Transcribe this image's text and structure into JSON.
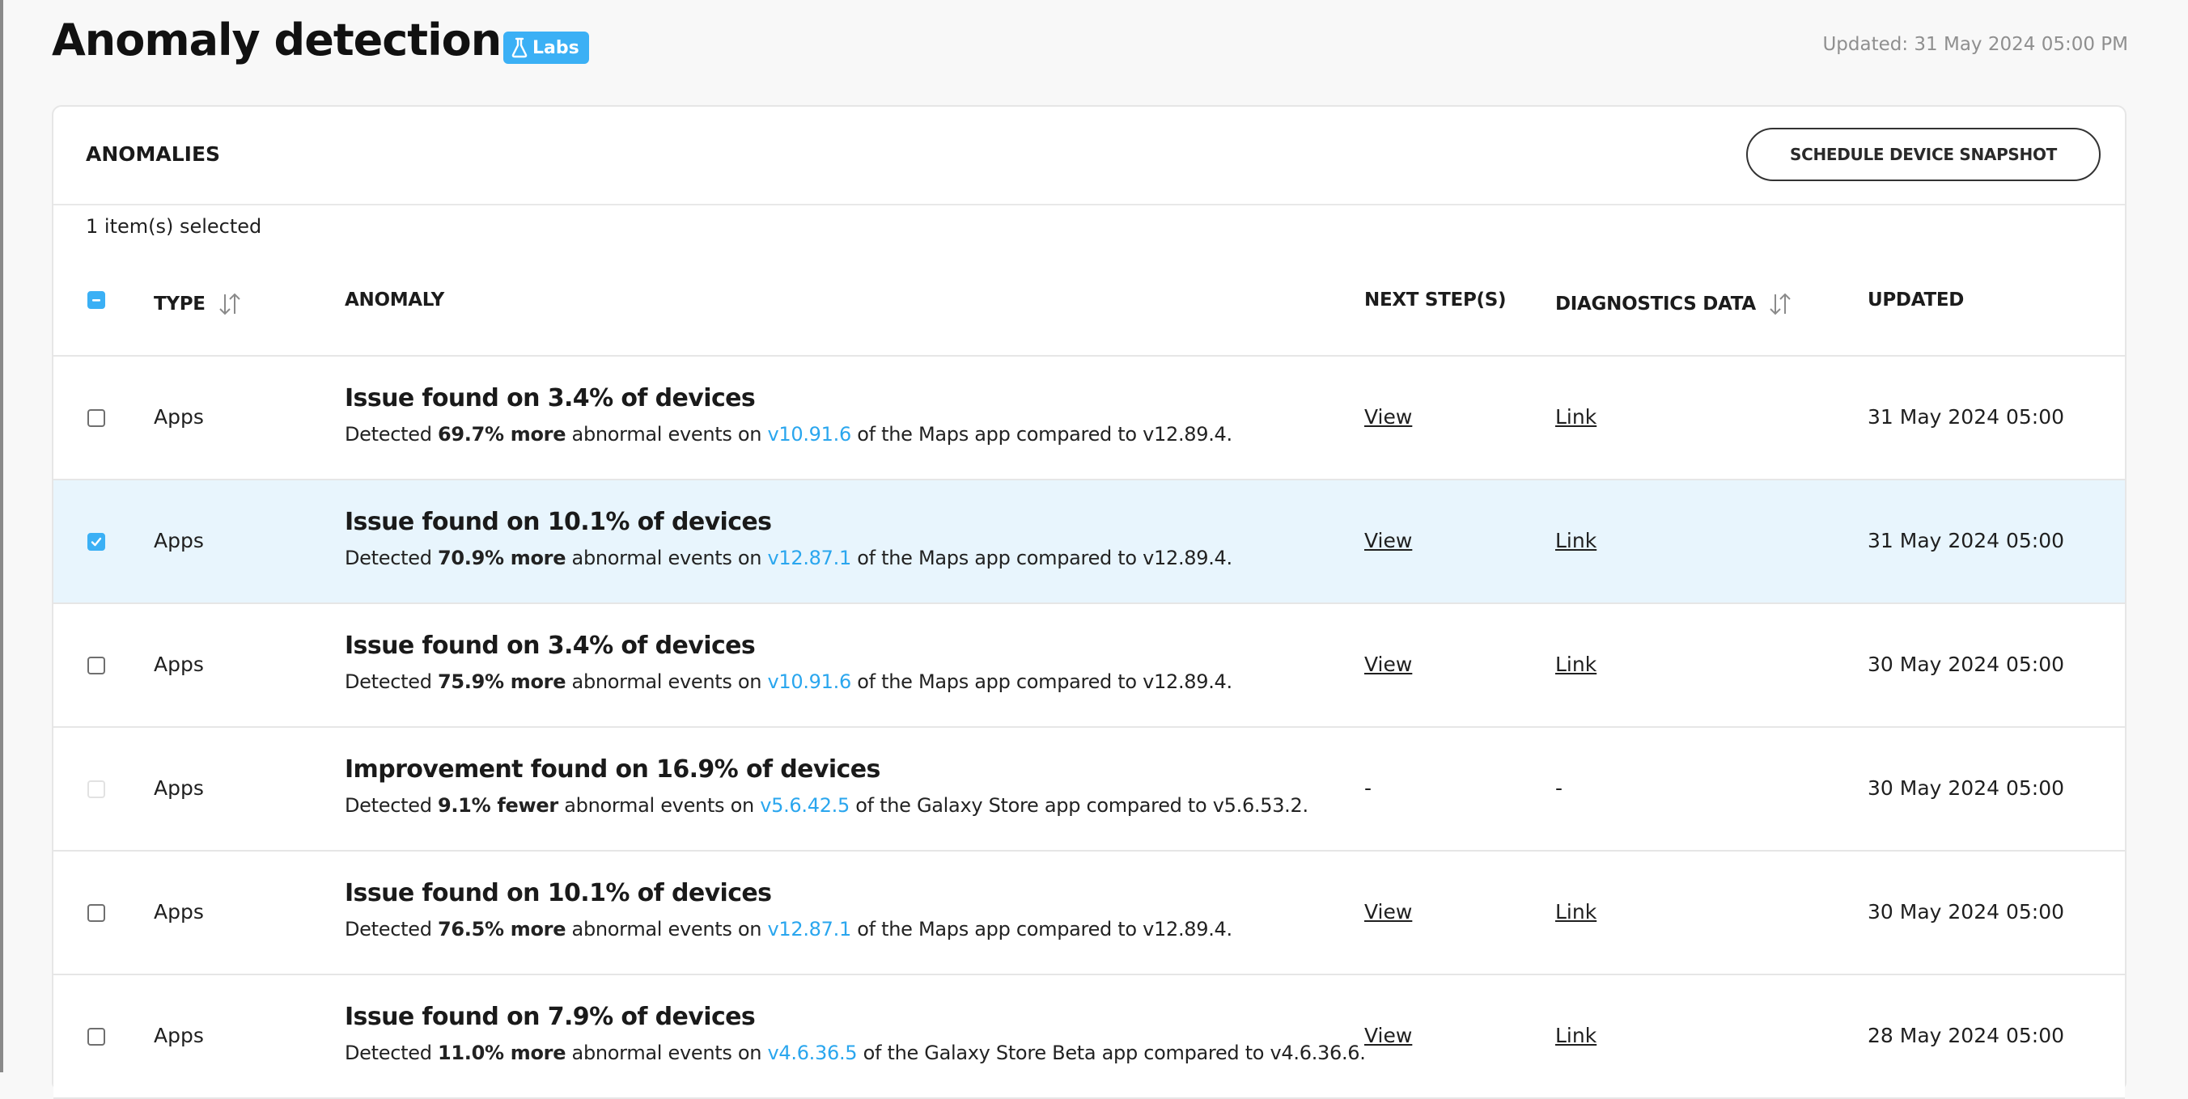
{
  "page": {
    "title": "Anomaly detection",
    "badge": "Labs",
    "updated": "Updated: 31 May 2024 05:00 PM"
  },
  "card": {
    "title": "ANOMALIES",
    "action_button": "SCHEDULE DEVICE SNAPSHOT",
    "selected_count": "1 item(s) selected"
  },
  "columns": {
    "type": "TYPE",
    "anomaly": "ANOMALY",
    "next_steps": "NEXT STEP(S)",
    "diagnostics": "DIAGNOSTICS DATA",
    "updated": "UPDATED"
  },
  "colors": {
    "accent": "#3bb0f5",
    "link": "#2aa6ee",
    "selected_row": "#e8f5fd"
  },
  "rows": [
    {
      "checked": false,
      "disabled": false,
      "type": "Apps",
      "title": "Issue found on 3.4% of devices",
      "desc_prefix": "Detected ",
      "desc_bold": "69.7% more",
      "desc_mid": " abnormal events on ",
      "version": "v10.91.6",
      "desc_suffix": " of the Maps app compared to v12.89.4.",
      "next": "View",
      "diag": "Link",
      "updated": "31 May 2024 05:00"
    },
    {
      "checked": true,
      "disabled": false,
      "type": "Apps",
      "title": "Issue found on 10.1% of devices",
      "desc_prefix": "Detected ",
      "desc_bold": "70.9% more",
      "desc_mid": " abnormal events on ",
      "version": "v12.87.1",
      "desc_suffix": " of the Maps app compared to v12.89.4.",
      "next": "View",
      "diag": "Link",
      "updated": "31 May 2024 05:00"
    },
    {
      "checked": false,
      "disabled": false,
      "type": "Apps",
      "title": "Issue found on 3.4% of devices",
      "desc_prefix": "Detected ",
      "desc_bold": "75.9% more",
      "desc_mid": " abnormal events on ",
      "version": "v10.91.6",
      "desc_suffix": " of the Maps app compared to v12.89.4.",
      "next": "View",
      "diag": "Link",
      "updated": "30 May 2024 05:00"
    },
    {
      "checked": false,
      "disabled": true,
      "type": "Apps",
      "title": "Improvement found on 16.9% of devices",
      "desc_prefix": "Detected ",
      "desc_bold": "9.1% fewer",
      "desc_mid": " abnormal events on ",
      "version": "v5.6.42.5",
      "desc_suffix": " of the Galaxy Store app compared to v5.6.53.2.",
      "next": "-",
      "diag": "-",
      "updated": "30 May 2024 05:00"
    },
    {
      "checked": false,
      "disabled": false,
      "type": "Apps",
      "title": "Issue found on 10.1% of devices",
      "desc_prefix": "Detected ",
      "desc_bold": "76.5% more",
      "desc_mid": " abnormal events on ",
      "version": "v12.87.1",
      "desc_suffix": " of the Maps app compared to v12.89.4.",
      "next": "View",
      "diag": "Link",
      "updated": "30 May 2024 05:00"
    },
    {
      "checked": false,
      "disabled": false,
      "type": "Apps",
      "title": "Issue found on 7.9% of devices",
      "desc_prefix": "Detected ",
      "desc_bold": "11.0% more",
      "desc_mid": " abnormal events on ",
      "version": "v4.6.36.5",
      "desc_suffix": " of the Galaxy Store Beta app compared to v4.6.36.6.",
      "next": "View",
      "diag": "Link",
      "updated": "28 May 2024 05:00"
    }
  ]
}
